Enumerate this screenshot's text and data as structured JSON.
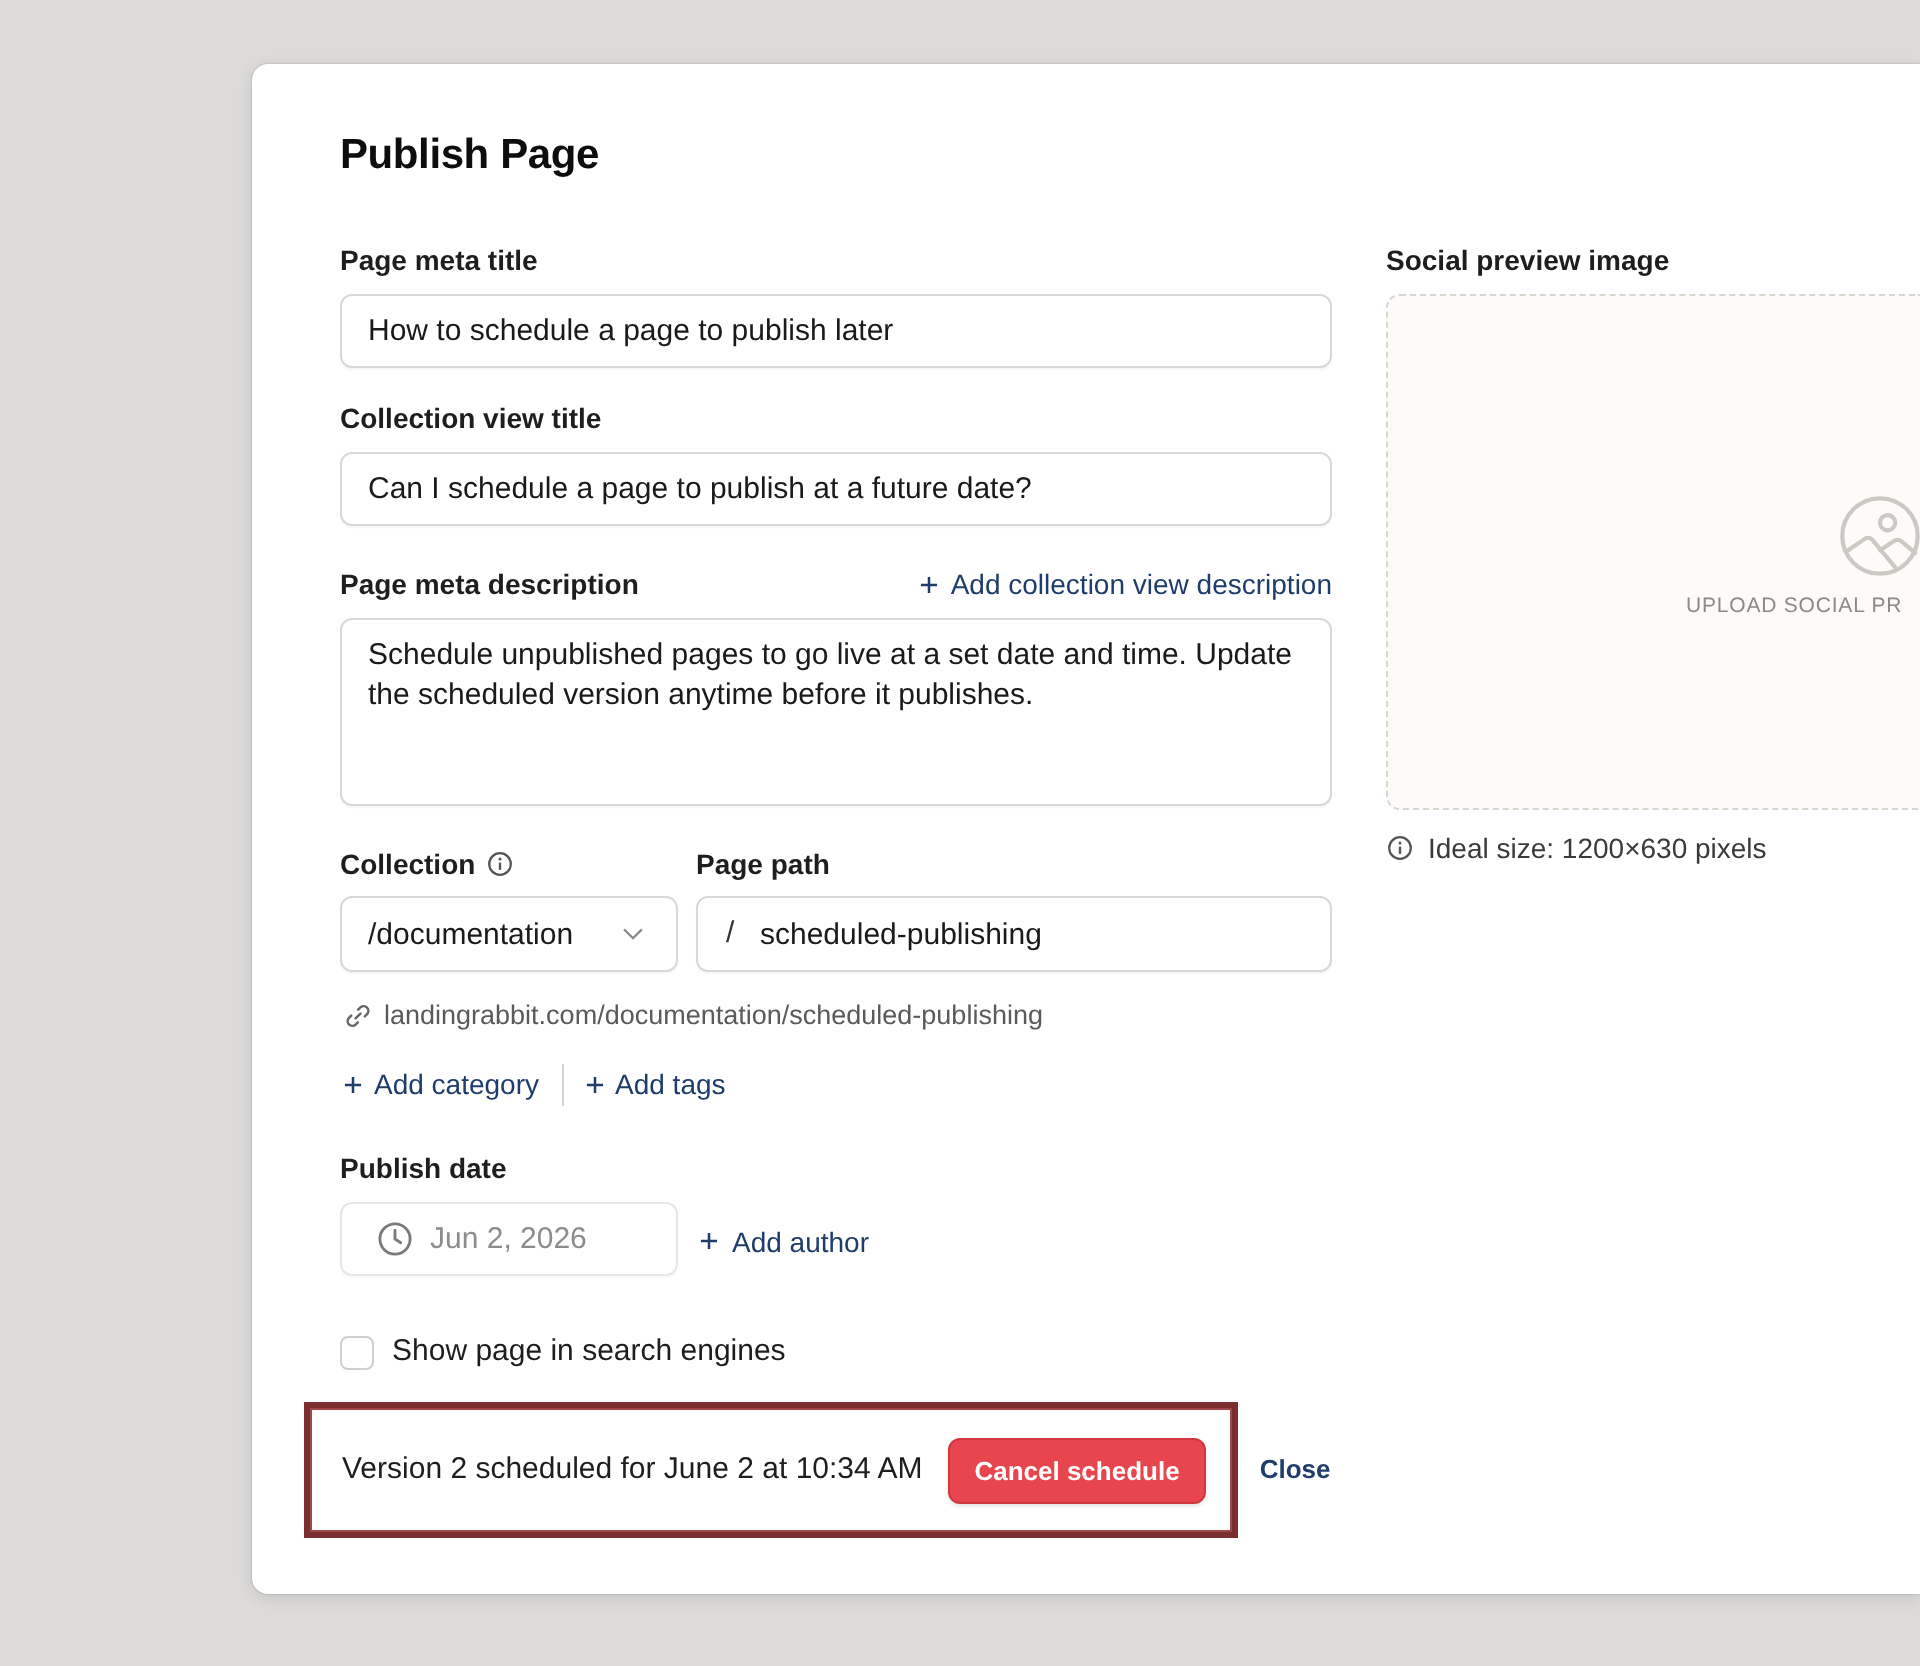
{
  "dialog": {
    "title": "Publish Page"
  },
  "meta_title": {
    "label": "Page meta title",
    "value": "How to schedule a page to publish later"
  },
  "collection_view_title": {
    "label": "Collection view title",
    "value": "Can I schedule a page to publish at a future date?"
  },
  "meta_description": {
    "label": "Page meta description",
    "action": "Add collection view description",
    "value": "Schedule unpublished pages to go live at a set date and time. Update the scheduled version anytime before it publishes."
  },
  "collection": {
    "label": "Collection",
    "value": "/documentation"
  },
  "page_path": {
    "label": "Page path",
    "prefix": "/",
    "value": "scheduled-publishing"
  },
  "page_url": "landingrabbit.com/documentation/scheduled-publishing",
  "add_actions": [
    "Add category",
    "Add tags"
  ],
  "publish_date": {
    "label": "Publish date",
    "value": "Jun 2, 2026",
    "disabled": true
  },
  "add_author": "Add author",
  "search_engines": {
    "label": "Show page in search engines",
    "checked": false
  },
  "social_preview": {
    "label": "Social preview image",
    "upload_text": "UPLOAD SOCIAL PR",
    "hint": "Ideal size: 1200×630 pixels"
  },
  "footer": {
    "status": "Version 2 scheduled for June 2 at 10:34 AM",
    "highlighted": true,
    "cancel_button": "Cancel schedule",
    "close_link": "Close"
  }
}
